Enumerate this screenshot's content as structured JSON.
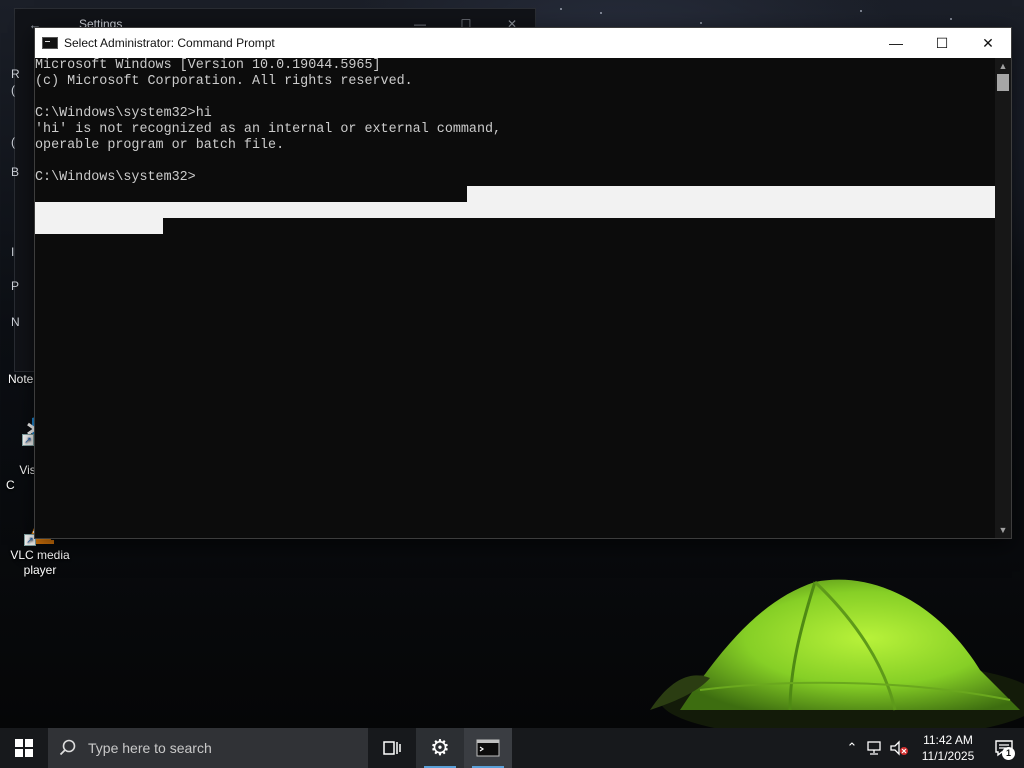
{
  "settings_window": {
    "title": "Settings",
    "back_glyph": "←",
    "side_letters": [
      "R",
      "(",
      "B",
      "(",
      "I",
      "N",
      "P"
    ]
  },
  "cmd_window": {
    "title": "Select Administrator: Command Prompt",
    "lines": [
      "Microsoft Windows [Version 10.0.19044.5965]",
      "(c) Microsoft Corporation. All rights reserved.",
      "",
      "C:\\Windows\\system32>hi",
      "'hi' is not recognized as an internal or external command,",
      "operable program or batch file.",
      "",
      "C:\\Windows\\system32>"
    ],
    "controls": {
      "minimize": "—",
      "maximize": "☐",
      "close": "✕"
    }
  },
  "desktop_icons": [
    {
      "name": "notepad",
      "label": "Note",
      "icon": "notepad-icon"
    },
    {
      "name": "vscode",
      "label": "Visua\nC",
      "icon": "vscode-icon"
    },
    {
      "name": "vlc",
      "label": "VLC media\nplayer",
      "icon": "vlc-icon"
    }
  ],
  "taskbar": {
    "search_placeholder": "Type here to search",
    "clock_time": "11:42 AM",
    "clock_date": "11/1/2025",
    "notification_count": "1",
    "pinned": [
      "task-view-icon",
      "settings-gear-icon",
      "command-prompt-icon"
    ]
  },
  "colors": {
    "console_bg": "#0c0c0c",
    "console_text": "#cccccc",
    "selection": "#f2f2f2",
    "taskbar_bg": "#17191c",
    "tent_green": "#8bd62a"
  }
}
